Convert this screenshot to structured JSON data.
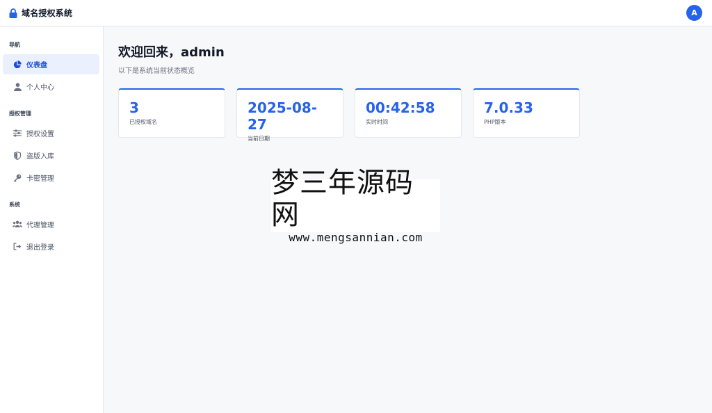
{
  "header": {
    "title": "域名授权系统",
    "brand_icon": "lock-icon",
    "avatar_letter": "A"
  },
  "sidebar": {
    "sections": [
      {
        "title": "导航",
        "items": [
          {
            "label": "仪表盘",
            "icon": "pie-chart-icon",
            "active": true
          },
          {
            "label": "个人中心",
            "icon": "user-icon",
            "active": false
          }
        ]
      },
      {
        "title": "授权管理",
        "items": [
          {
            "label": "授权设置",
            "icon": "sliders-icon",
            "active": false
          },
          {
            "label": "盗版入库",
            "icon": "shield-icon",
            "active": false
          },
          {
            "label": "卡密管理",
            "icon": "key-icon",
            "active": false
          }
        ]
      },
      {
        "title": "系统",
        "items": [
          {
            "label": "代理管理",
            "icon": "users-icon",
            "active": false
          },
          {
            "label": "退出登录",
            "icon": "logout-icon",
            "active": false
          }
        ]
      }
    ]
  },
  "main": {
    "title": "欢迎回来，admin",
    "subtitle": "以下是系统当前状态概览",
    "cards": [
      {
        "value": "3",
        "label": "已授权域名"
      },
      {
        "value": "2025-08-27",
        "label": "当前日期"
      },
      {
        "value": "00:42:58",
        "label": "实时时间"
      },
      {
        "value": "7.0.33",
        "label": "PHP版本"
      }
    ]
  },
  "watermark": {
    "text": "梦三年源码网",
    "url": "www.mengsannian.com"
  },
  "colors": {
    "accent": "#2563eb",
    "active_bg": "#eaf0fd",
    "page_bg": "#f7f8fa"
  }
}
